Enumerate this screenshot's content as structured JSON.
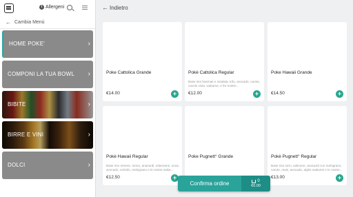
{
  "header": {
    "allergeni_label": "Allergeni",
    "info_icon_glyph": "i"
  },
  "sidebar": {
    "back_label": "Cambia Menù",
    "back_arrow": "←",
    "categories": [
      {
        "label": "HOME POKE'"
      },
      {
        "label": "COMPONI LA TUA BOWL"
      },
      {
        "label": "BIBITE"
      },
      {
        "label": "BIRRE E VINI"
      },
      {
        "label": "DOLCI"
      }
    ],
    "chevron": "›"
  },
  "main": {
    "back_label": "Indietro",
    "back_arrow": "←",
    "add_glyph": "+",
    "products": [
      {
        "name": "Poke Cattolica Grande",
        "desc": "",
        "price": "€14.00"
      },
      {
        "name": "Pokè Cattolica Regular",
        "desc": "Base riso basmati e insalata, tofu, avocado, carote, cavolo viola, wakame, e fre nostre...",
        "price": "€12.00"
      },
      {
        "name": "Poke Hawaii Grande",
        "desc": "",
        "price": "€14.50"
      },
      {
        "name": "Pokè Hawaii Regular",
        "desc": "Base riso Venere, tonno, anacardi, edamame, uova, avocado, cetriolo, melograno e le nostre salse...",
        "price": "€12.50"
      },
      {
        "name": "Poke Pugnett° Grande",
        "desc": "",
        "price": ""
      },
      {
        "name": "Pokè Pugnett° Regular",
        "desc": "Base riso nero, salmone, anacardi con melograno, carote, mais, avocado, alghe wakame e le nostre...",
        "price": "€13.00"
      }
    ]
  },
  "cart": {
    "confirm_label": "Confirma ordine",
    "count": "0",
    "total": "€0.00"
  },
  "colors": {
    "accent": "#2aa39a",
    "category_gray": "#8a8a8a"
  }
}
